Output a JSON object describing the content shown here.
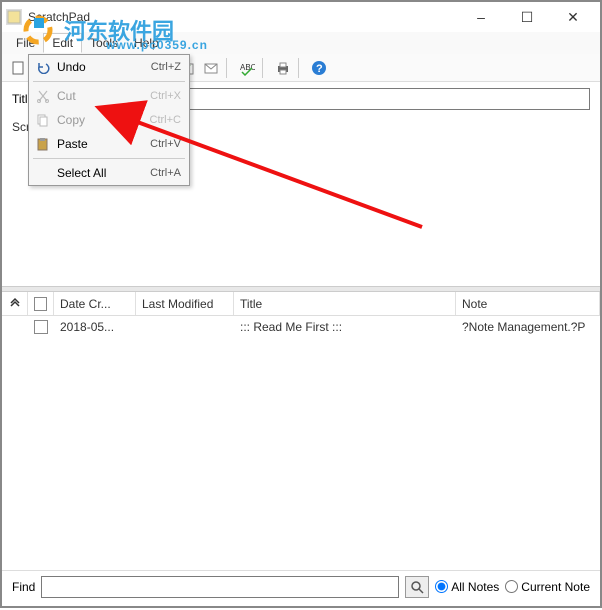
{
  "window": {
    "title": "ScratchPad",
    "min": "–",
    "max": "☐",
    "close": "✕"
  },
  "menubar": {
    "file": "File",
    "edit": "Edit",
    "tools": "Tools",
    "help": "Help"
  },
  "context": {
    "undo": "Undo",
    "undo_s": "Ctrl+Z",
    "cut": "Cut",
    "cut_s": "Ctrl+X",
    "copy": "Copy",
    "copy_s": "Ctrl+C",
    "paste": "Paste",
    "paste_s": "Ctrl+V",
    "selectall": "Select All",
    "selectall_s": "Ctrl+A"
  },
  "title_field": {
    "label": "Title:",
    "value": ""
  },
  "editor": {
    "snippet": "Scra"
  },
  "columns": {
    "chev": "",
    "chk": "",
    "date": "Date Cr...",
    "mod": "Last Modified",
    "title": "Title",
    "note": "Note"
  },
  "rows": [
    {
      "date": "2018-05...",
      "mod": "",
      "title": "::: Read Me First :::",
      "note": "?Note Management.?P"
    }
  ],
  "findbar": {
    "label": "Find",
    "value": "",
    "all": "All Notes",
    "current": "Current Note"
  },
  "watermark": {
    "text": "河东软件园",
    "url": "www.pc0359.cn"
  }
}
